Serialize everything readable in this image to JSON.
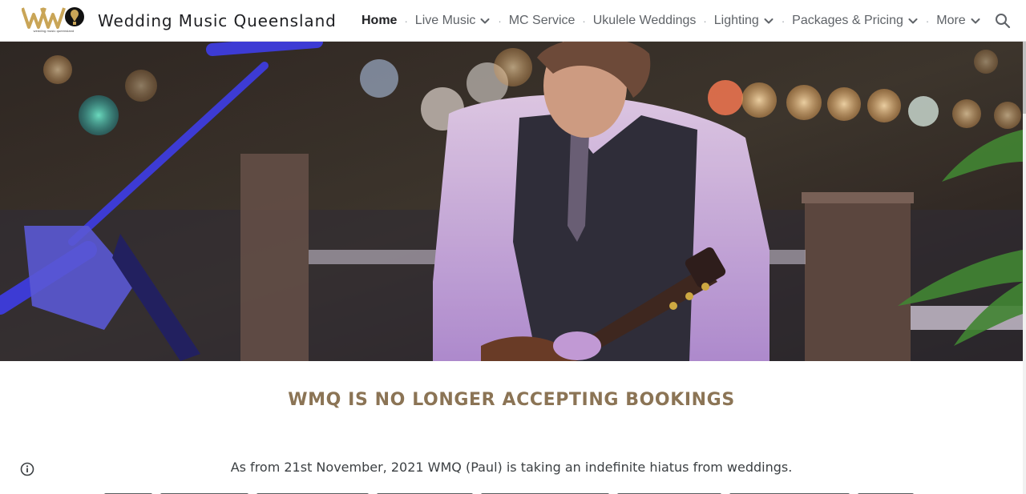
{
  "header": {
    "logo_text": "WMQ",
    "logo_subtext": "wedding music queensland",
    "site_title": "Wedding Music Queensland"
  },
  "nav": {
    "items": [
      {
        "label": "Home",
        "active": true,
        "dropdown": false
      },
      {
        "label": "Live Music",
        "active": false,
        "dropdown": true
      },
      {
        "label": "MC Service",
        "active": false,
        "dropdown": false
      },
      {
        "label": "Ukulele Weddings",
        "active": false,
        "dropdown": false
      },
      {
        "label": "Lighting",
        "active": false,
        "dropdown": true
      },
      {
        "label": "Packages & Pricing",
        "active": false,
        "dropdown": true
      },
      {
        "label": "More",
        "active": false,
        "dropdown": true
      }
    ],
    "separator": "·",
    "search_icon": "search-icon"
  },
  "main": {
    "headline": "WMQ IS NO LONGER ACCEPTING BOOKINGS",
    "paragraph": "As from 21st November, 2021 WMQ (Paul) is taking an indefinite hiatus from weddings."
  },
  "colors": {
    "accent_gold": "#8b7455",
    "logo_gold": "#c9a557",
    "text_dark": "#202124",
    "nav_text": "#5f6368"
  }
}
